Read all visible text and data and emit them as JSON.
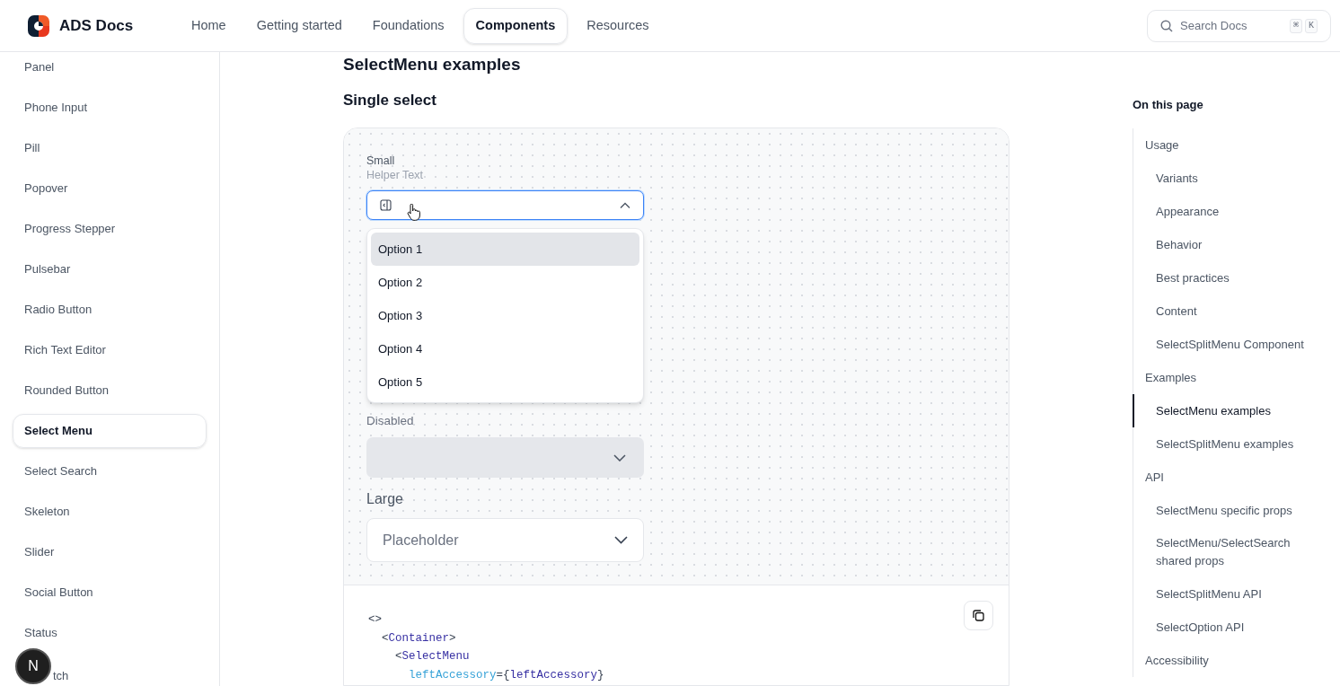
{
  "header": {
    "logo": "ADS Docs",
    "nav": [
      {
        "label": "Home",
        "selected": false
      },
      {
        "label": "Getting started",
        "selected": false
      },
      {
        "label": "Foundations",
        "selected": false
      },
      {
        "label": "Components",
        "selected": true
      },
      {
        "label": "Resources",
        "selected": false
      }
    ],
    "search": {
      "placeholder": "Search Docs",
      "keys": [
        "⌘",
        "K"
      ]
    }
  },
  "sidebar": {
    "items": [
      {
        "label": "Panel",
        "selected": false
      },
      {
        "label": "Phone Input",
        "selected": false
      },
      {
        "label": "Pill",
        "selected": false
      },
      {
        "label": "Popover",
        "selected": false
      },
      {
        "label": "Progress Stepper",
        "selected": false
      },
      {
        "label": "Pulsebar",
        "selected": false
      },
      {
        "label": "Radio Button",
        "selected": false
      },
      {
        "label": "Rich Text Editor",
        "selected": false
      },
      {
        "label": "Rounded Button",
        "selected": false
      },
      {
        "label": "Select Menu",
        "selected": true
      },
      {
        "label": "Select Search",
        "selected": false
      },
      {
        "label": "Skeleton",
        "selected": false
      },
      {
        "label": "Slider",
        "selected": false
      },
      {
        "label": "Social Button",
        "selected": false
      },
      {
        "label": "Status",
        "selected": false
      },
      {
        "label": "tch",
        "selected": false,
        "kind": "covered"
      }
    ],
    "badge": "N"
  },
  "main": {
    "heading": "SelectMenu examples",
    "subheading": "Single select",
    "small_select": {
      "label": "Small",
      "helper": "Helper Text",
      "expanded": true,
      "options": [
        {
          "label": "Option 1",
          "selected": true
        },
        {
          "label": "Option 2",
          "selected": false
        },
        {
          "label": "Option 3",
          "selected": false
        },
        {
          "label": "Option 4",
          "selected": false
        },
        {
          "label": "Option 5",
          "selected": false
        }
      ]
    },
    "disabled_select": {
      "label": "Disabled",
      "disabled": true
    },
    "large_select": {
      "label": "Large",
      "placeholder": "Placeholder"
    },
    "code": [
      {
        "parts": [
          {
            "kind": "punct",
            "text": "<>"
          }
        ],
        "children": [
          {
            "parts": [
              {
                "kind": "punct",
                "text": "<"
              },
              {
                "kind": "tag",
                "text": "Container"
              },
              {
                "kind": "punct",
                "text": ">"
              }
            ],
            "children": [
              {
                "parts": [
                  {
                    "kind": "punct",
                    "text": "<"
                  },
                  {
                    "kind": "tag",
                    "text": "SelectMenu"
                  }
                ],
                "children": [
                  {
                    "parts": [
                      {
                        "kind": "attr",
                        "text": "leftAccessory"
                      },
                      {
                        "kind": "punct",
                        "text": "={"
                      },
                      {
                        "kind": "tag",
                        "text": "leftAccessory"
                      },
                      {
                        "kind": "punct",
                        "text": "}"
                      }
                    ]
                  }
                ]
              }
            ]
          }
        ]
      }
    ]
  },
  "toc": {
    "title": "On this page",
    "items": [
      {
        "label": "Usage",
        "selected": false,
        "children": [
          {
            "label": "Variants",
            "selected": false
          },
          {
            "label": "Appearance",
            "selected": false
          },
          {
            "label": "Behavior",
            "selected": false
          },
          {
            "label": "Best practices",
            "selected": false
          },
          {
            "label": "Content",
            "selected": false
          },
          {
            "label": "SelectSplitMenu Component",
            "selected": false
          }
        ]
      },
      {
        "label": "Examples",
        "selected": false,
        "children": [
          {
            "label": "SelectMenu examples",
            "selected": true
          },
          {
            "label": "SelectSplitMenu examples",
            "selected": false
          }
        ]
      },
      {
        "label": "API",
        "selected": false,
        "children": [
          {
            "label": "SelectMenu specific props",
            "selected": false
          },
          {
            "label": "SelectMenu/SelectSearch shared props",
            "selected": false
          },
          {
            "label": "SelectSplitMenu API",
            "selected": false
          },
          {
            "label": "SelectOption API",
            "selected": false
          }
        ]
      },
      {
        "label": "Accessibility",
        "selected": false
      }
    ]
  }
}
